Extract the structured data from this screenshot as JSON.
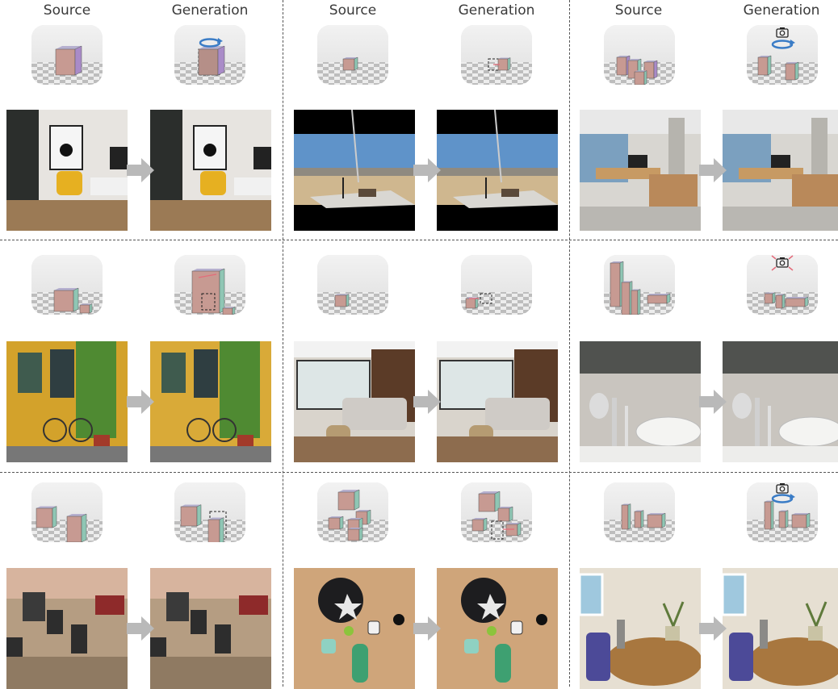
{
  "headers": [
    "Source",
    "Generation",
    "Source",
    "Generation",
    "Source",
    "Generation"
  ],
  "icons": {
    "rotate": "rotate-arrow-icon",
    "camera": "camera-icon",
    "zoom": "zoom-arrows-icon",
    "arrow": "right-arrow-icon"
  },
  "colors": {
    "object_face": "#c79a92",
    "object_side_green": "#8fc6b4",
    "object_side_purple": "#a98bc8",
    "edit_outline": "#222222",
    "edit_arrow": "#e46b7a",
    "rotate_blue": "#3a7cc6",
    "arrow_gray": "#b9b9b9"
  }
}
